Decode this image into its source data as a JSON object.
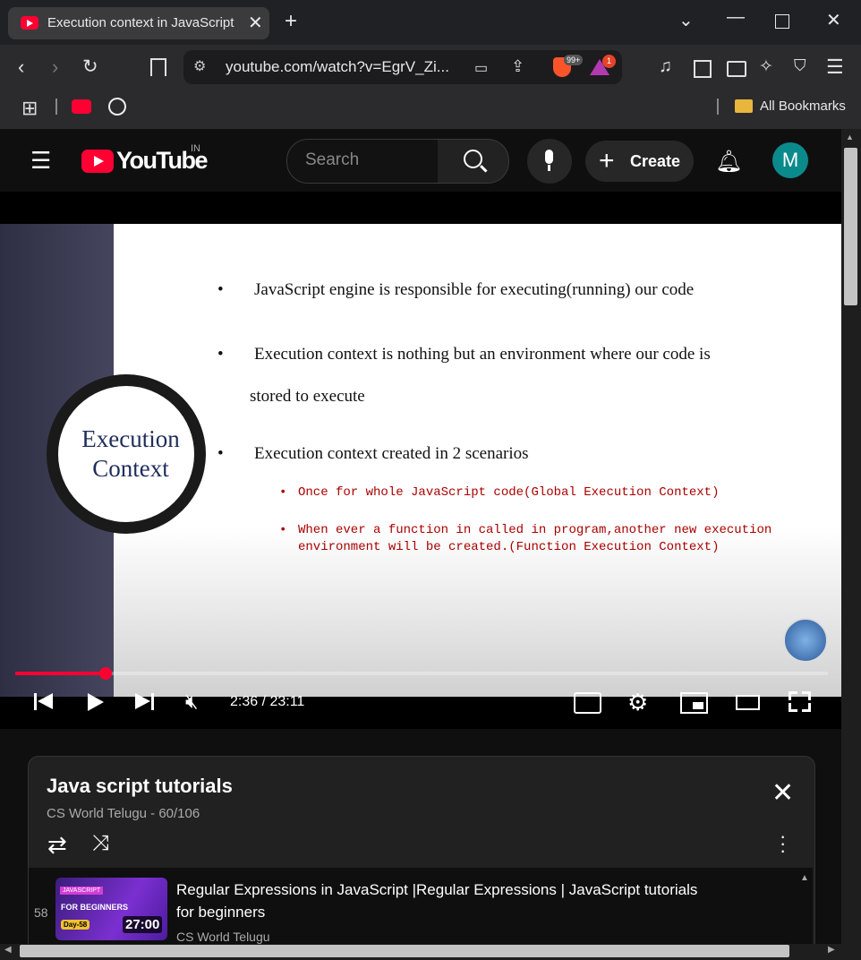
{
  "browser": {
    "tab_title": "Execution context in JavaScript",
    "url": "youtube.com/watch?v=EgrV_Zi...",
    "brave_badge": "99+",
    "alert_badge": "1",
    "bookmarks_label": "All Bookmarks"
  },
  "youtube": {
    "logo_text": "YouTube",
    "country": "IN",
    "search_placeholder": "Search",
    "create_label": "Create",
    "avatar_letter": "M"
  },
  "slide": {
    "circle_title_1": "Execution",
    "circle_title_2": "Context",
    "bullet_1": "JavaScript engine is responsible for executing(running) our code",
    "bullet_2a": "Execution context is nothing but an environment where our code is",
    "bullet_2b": "stored to execute",
    "bullet_3": "Execution context created in 2 scenarios",
    "sub_1": "Once for whole JavaScript code(Global Execution Context)",
    "sub_2a": "When ever a function in called in program,another new execution",
    "sub_2b": "environment will be created.(Function Execution Context)"
  },
  "player": {
    "time": "2:36 / 23:11",
    "progress_fraction": 0.111
  },
  "playlist": {
    "title": "Java script tutorials",
    "subtitle": "CS World Telugu - 60/106",
    "items": [
      {
        "index": "58",
        "title_1": "Regular Expressions in JavaScript |Regular Expressions | JavaScript tutorials",
        "title_2": "for beginners",
        "channel": "CS World Telugu",
        "duration": "27:00",
        "thumb_tag": "JAVASCRIPT",
        "thumb_caption": "FOR BEGINNERS",
        "thumb_day": "Day-58"
      }
    ]
  }
}
